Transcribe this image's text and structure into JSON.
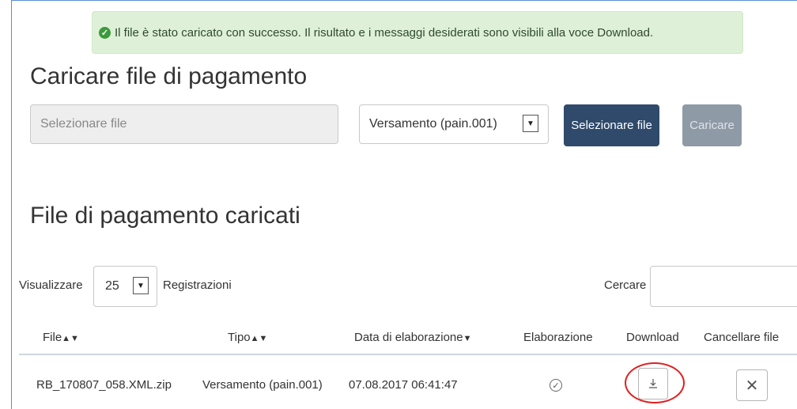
{
  "alert": {
    "icon": "check-circle-icon",
    "message": "Il file è stato caricato con successo. Il risultato e i messaggi desiderati sono visibili alla voce Download."
  },
  "upload": {
    "title": "Caricare file di pagamento",
    "file_placeholder": "Selezionare file",
    "type_value": "Versamento (pain.001)",
    "select_button": "Selezionare file",
    "upload_button": "Caricare"
  },
  "list": {
    "title": "File di pagamento caricati",
    "show_label": "Visualizzare",
    "page_size": "25",
    "records_label": "Registrazioni",
    "search_label": "Cercare",
    "columns": {
      "file": "File",
      "type": "Tipo",
      "date": "Data di elaborazione",
      "processing": "Elaborazione",
      "download": "Download",
      "delete": "Cancellare file"
    },
    "rows": [
      {
        "file": "RB_170807_058.XML.zip",
        "type": "Versamento (pain.001)",
        "date": "07.08.2017 06:41:47",
        "processing_icon": "check-circle-icon",
        "download_icon": "download-icon",
        "delete_icon": "close-icon"
      }
    ]
  },
  "colors": {
    "alert_bg": "#dff0d8",
    "primary_button": "#2f4a6a",
    "disabled_button": "#8e9aa6",
    "highlight": "#e02020"
  }
}
